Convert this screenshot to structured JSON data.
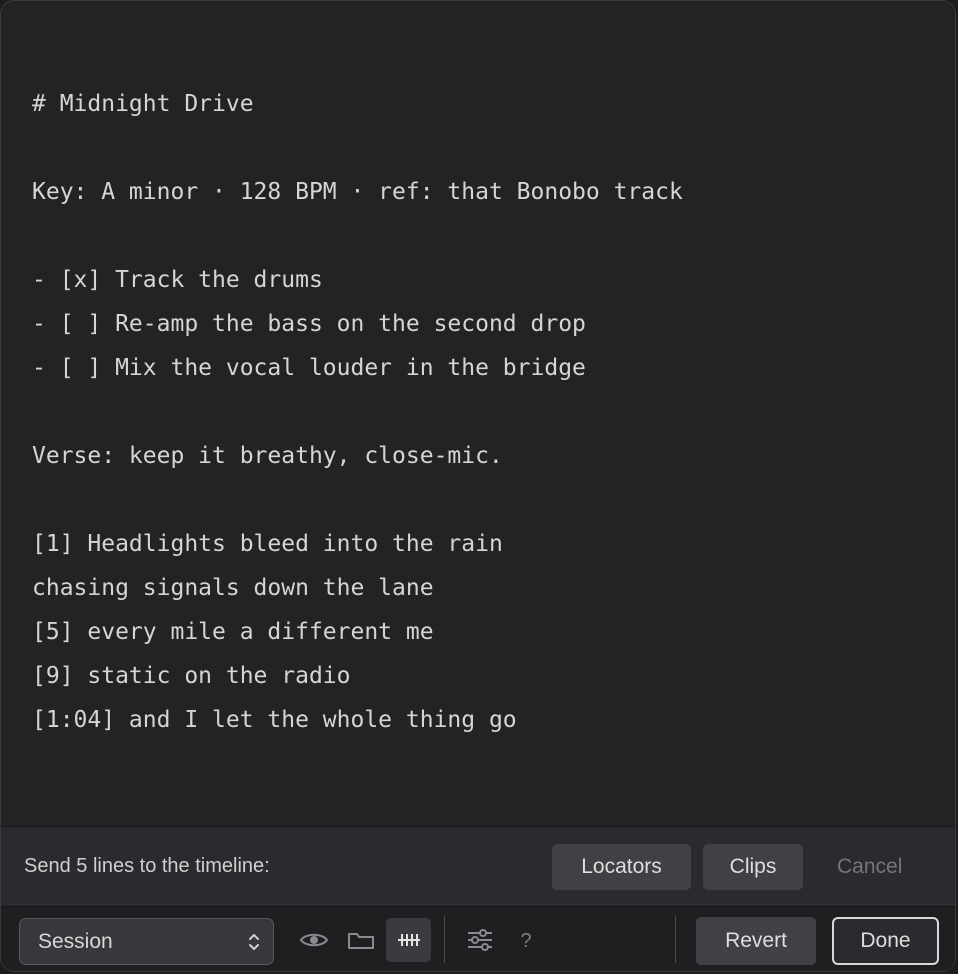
{
  "editor": {
    "lines": [
      "# Midnight Drive",
      "",
      "Key: A minor · 128 BPM · ref: that Bonobo track",
      "",
      "- [x] Track the drums",
      "- [ ] Re-amp the bass on the second drop",
      "- [ ] Mix the vocal louder in the bridge",
      "",
      "Verse: keep it breathy, close-mic.",
      "",
      "[1] Headlights bleed into the rain",
      "chasing signals down the lane",
      "[5] every mile a different me",
      "[9] static on the radio",
      "[1:04] and I let the whole thing go"
    ]
  },
  "sendbar": {
    "label": "Send 5 lines to the timeline:",
    "locators_label": "Locators",
    "clips_label": "Clips",
    "cancel_label": "Cancel"
  },
  "toolbar": {
    "select_value": "Session",
    "help_label": "?",
    "revert_label": "Revert",
    "done_label": "Done",
    "icons": [
      "eye-icon",
      "folder-icon",
      "grid-icon",
      "sliders-icon",
      "help-icon"
    ]
  },
  "colors": {
    "background": "#232326",
    "text": "#d5d5d5",
    "button": "#404045",
    "muted": "#75757a"
  }
}
